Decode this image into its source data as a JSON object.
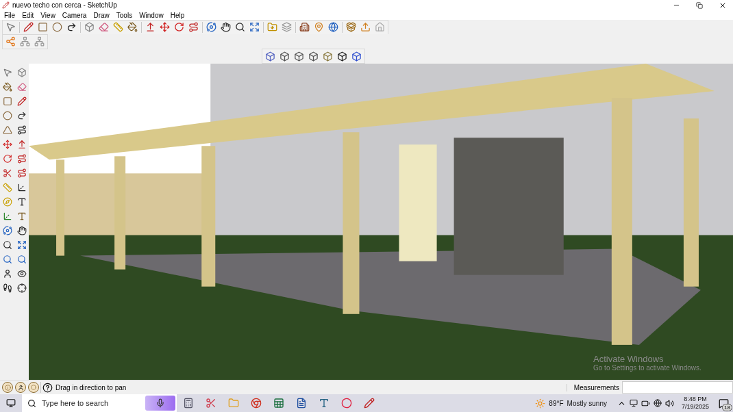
{
  "window": {
    "title": "nuevo techo con cerca - SketchUp"
  },
  "menu": [
    "File",
    "Edit",
    "View",
    "Camera",
    "Draw",
    "Tools",
    "Window",
    "Help"
  ],
  "overlay": {
    "title": "Activate Windows",
    "subtitle": "Go to Settings to activate Windows."
  },
  "status_bar": {
    "hint": "Drag in direction to pan",
    "measurements_label": "Measurements"
  },
  "taskbar": {
    "search_placeholder": "Type here to search",
    "weather": {
      "temperature": "89°F",
      "condition": "Mostly sunny"
    },
    "time": "8:48 PM",
    "date": "7/19/2025",
    "notifications": "18"
  }
}
